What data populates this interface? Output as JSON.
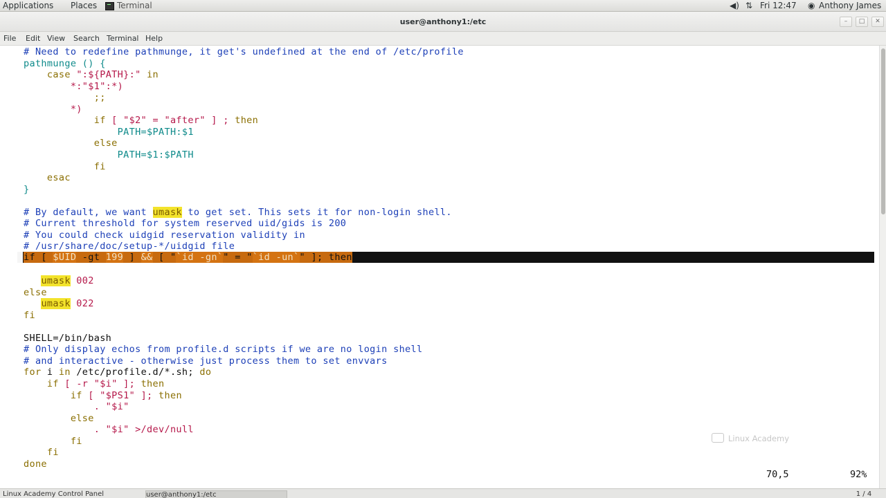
{
  "topbar": {
    "applications": "Applications",
    "places": "Places",
    "app_name": "Terminal",
    "clock": "Fri 12:47",
    "user": "Anthony James",
    "volume_icon": "◀)",
    "network_icon": "⇅",
    "user_icon": "◉"
  },
  "window": {
    "title": "user@anthony1:/etc",
    "minimize": "–",
    "maximize": "□",
    "close": "✕"
  },
  "menubar": [
    "File",
    "Edit",
    "View",
    "Search",
    "Terminal",
    "Help"
  ],
  "code_lines": [
    [
      {
        "t": "# Need to redefine pathmunge, it get's undefined at the end of /etc/profile",
        "c": "c"
      }
    ],
    [
      {
        "t": "pathmunge () {",
        "c": "id"
      }
    ],
    [
      {
        "t": "    ",
        "c": "pl"
      },
      {
        "t": "case",
        "c": "kw"
      },
      {
        "t": " \":${PATH}:\" ",
        "c": "st"
      },
      {
        "t": "in",
        "c": "kw"
      }
    ],
    [
      {
        "t": "        *:\"$1\":*)",
        "c": "st"
      }
    ],
    [
      {
        "t": "            ;;",
        "c": "kw"
      }
    ],
    [
      {
        "t": "        *)",
        "c": "st"
      }
    ],
    [
      {
        "t": "            ",
        "c": "pl"
      },
      {
        "t": "if",
        "c": "kw"
      },
      {
        "t": " [ \"$2\" = \"after\" ] ; ",
        "c": "st"
      },
      {
        "t": "then",
        "c": "kw"
      }
    ],
    [
      {
        "t": "                PATH=$PATH:$1",
        "c": "id"
      }
    ],
    [
      {
        "t": "            ",
        "c": "pl"
      },
      {
        "t": "else",
        "c": "kw"
      }
    ],
    [
      {
        "t": "                PATH=$1:$PATH",
        "c": "id"
      }
    ],
    [
      {
        "t": "            ",
        "c": "pl"
      },
      {
        "t": "fi",
        "c": "kw"
      }
    ],
    [
      {
        "t": "    ",
        "c": "pl"
      },
      {
        "t": "esac",
        "c": "kw"
      }
    ],
    [
      {
        "t": "}",
        "c": "id"
      }
    ],
    [
      {
        "t": "",
        "c": "pl"
      }
    ],
    [
      {
        "t": "# By default, we want ",
        "c": "c"
      },
      {
        "t": "umask",
        "c": "hi"
      },
      {
        "t": " to get set. This sets it for non-login shell.",
        "c": "c"
      }
    ],
    [
      {
        "t": "# Current threshold for system reserved uid/gids is 200",
        "c": "c"
      }
    ],
    [
      {
        "t": "# You could check uidgid reservation validity in",
        "c": "c"
      }
    ],
    [
      {
        "t": "# /usr/share/doc/setup-*/uidgid file",
        "c": "c"
      }
    ],
    [
      {
        "t": "",
        "c": "pl"
      }
    ],
    [
      {
        "t": "   ",
        "c": "pl"
      },
      {
        "t": "umask",
        "c": "hi"
      },
      {
        "t": " 002",
        "c": "st"
      }
    ],
    [
      {
        "t": "else",
        "c": "kw"
      }
    ],
    [
      {
        "t": "   ",
        "c": "pl"
      },
      {
        "t": "umask",
        "c": "hi"
      },
      {
        "t": " 022",
        "c": "st"
      }
    ],
    [
      {
        "t": "fi",
        "c": "kw"
      }
    ],
    [
      {
        "t": "",
        "c": "pl"
      }
    ],
    [
      {
        "t": "SHELL=/bin/bash",
        "c": "pl"
      }
    ],
    [
      {
        "t": "# Only display echos from profile.d scripts if we are no login shell",
        "c": "c"
      }
    ],
    [
      {
        "t": "# and interactive - otherwise just process them to set envvars",
        "c": "c"
      }
    ],
    [
      {
        "t": "for",
        "c": "kw"
      },
      {
        "t": " i ",
        "c": "pl"
      },
      {
        "t": "in",
        "c": "kw"
      },
      {
        "t": " /etc/profile.d/*.sh; ",
        "c": "pl"
      },
      {
        "t": "do",
        "c": "kw"
      }
    ],
    [
      {
        "t": "    ",
        "c": "pl"
      },
      {
        "t": "if",
        "c": "kw"
      },
      {
        "t": " [ -r \"$i\" ]; ",
        "c": "st"
      },
      {
        "t": "then",
        "c": "kw"
      }
    ],
    [
      {
        "t": "        ",
        "c": "pl"
      },
      {
        "t": "if",
        "c": "kw"
      },
      {
        "t": " [ \"$PS1\" ]; ",
        "c": "st"
      },
      {
        "t": "then",
        "c": "kw"
      }
    ],
    [
      {
        "t": "            . \"$i\"",
        "c": "st"
      }
    ],
    [
      {
        "t": "        ",
        "c": "pl"
      },
      {
        "t": "else",
        "c": "kw"
      }
    ],
    [
      {
        "t": "            . \"$i\" >/dev/null",
        "c": "st"
      }
    ],
    [
      {
        "t": "        ",
        "c": "pl"
      },
      {
        "t": "fi",
        "c": "kw"
      }
    ],
    [
      {
        "t": "    ",
        "c": "pl"
      },
      {
        "t": "fi",
        "c": "kw"
      }
    ],
    [
      {
        "t": "done",
        "c": "kw"
      }
    ]
  ],
  "cursor_line": [
    {
      "t": "if [ ",
      "c": "sel"
    },
    {
      "t": "$UID",
      "c": "selw"
    },
    {
      "t": " -gt ",
      "c": "sel"
    },
    {
      "t": "199",
      "c": "selw"
    },
    {
      "t": " ] ",
      "c": "sel"
    },
    {
      "t": "&&",
      "c": "selw"
    },
    {
      "t": " [ \"",
      "c": "sel"
    },
    {
      "t": "`id -gn`",
      "c": "selw"
    },
    {
      "t": "\" = \"",
      "c": "sel"
    },
    {
      "t": "`id -un`",
      "c": "selw"
    },
    {
      "t": "\" ]; then",
      "c": "sel"
    }
  ],
  "status": {
    "position": "70,5",
    "percent": "92%"
  },
  "watermark": "Linux Academy",
  "taskbar": {
    "task1": "Linux Academy Control Panel",
    "task2": "user@anthony1:/etc",
    "workspace": "1 / 4"
  }
}
